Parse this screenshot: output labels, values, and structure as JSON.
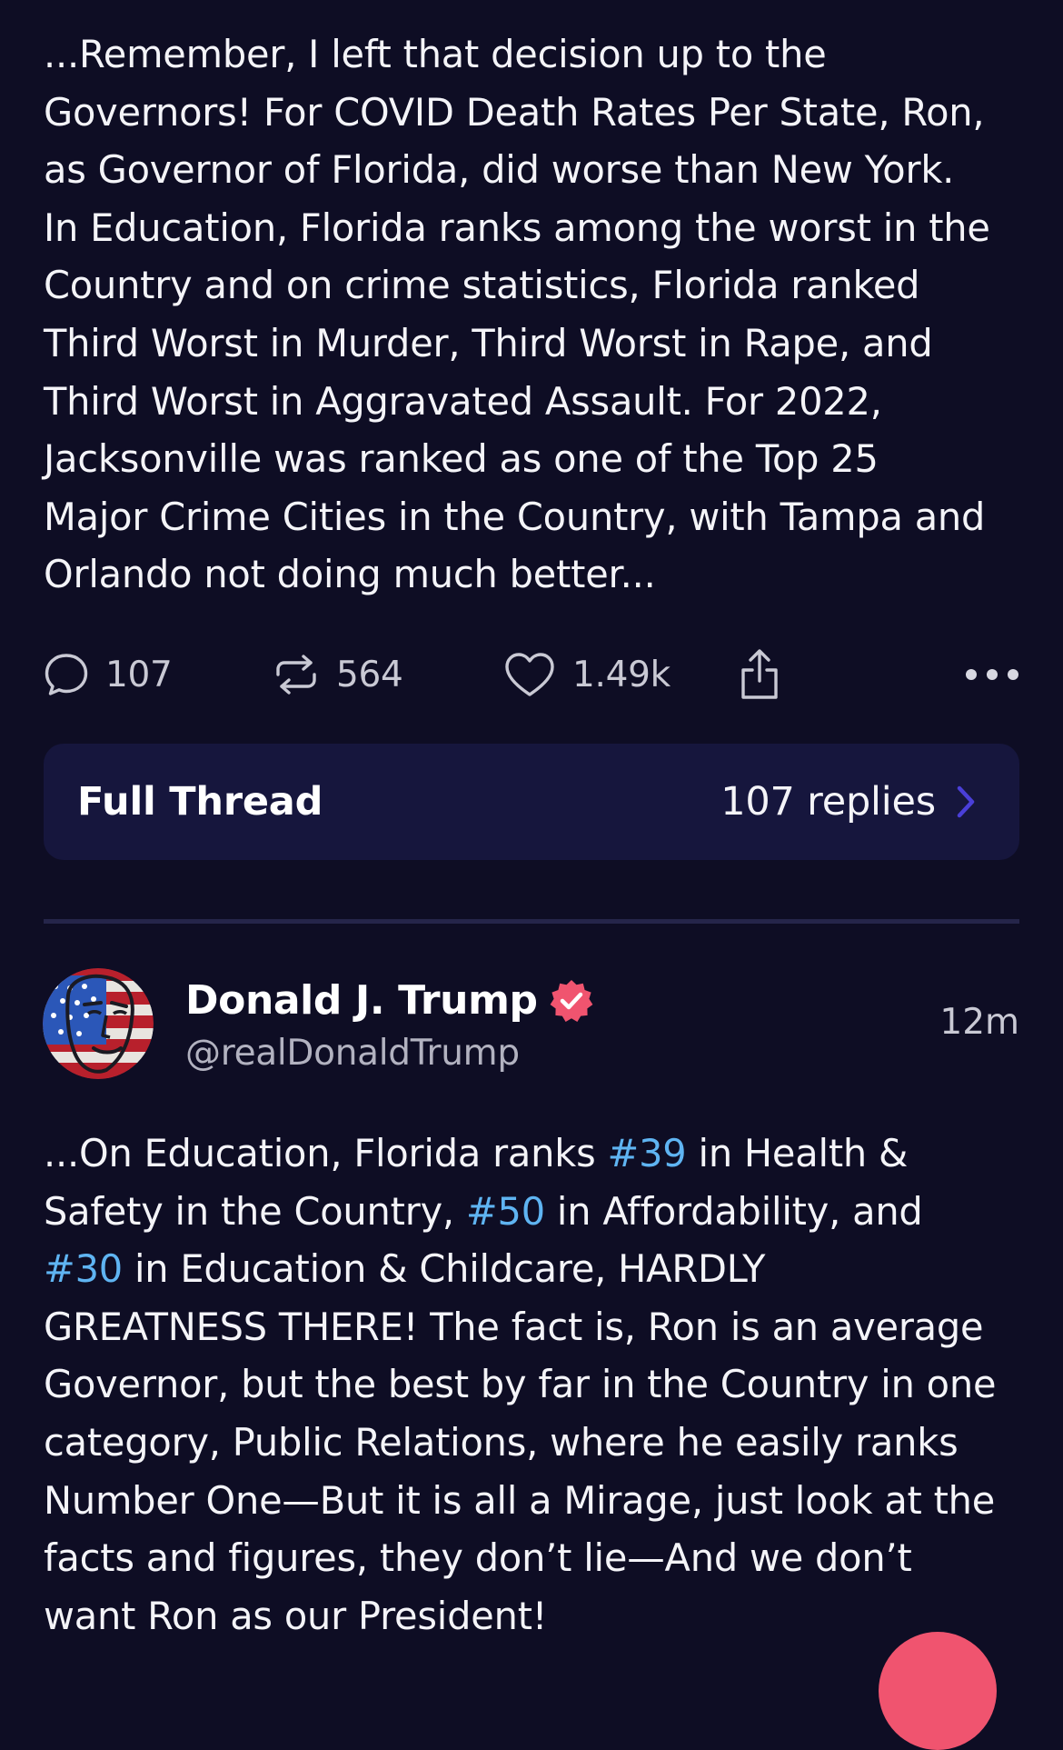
{
  "post1": {
    "text": "...Remember, I left that decision up to the\nGovernors! For COVID Death Rates Per State, Ron,\nas Governor of Florida, did worse than New York.\nIn Education, Florida ranks among the worst in the\nCountry and on crime statistics, Florida ranked\nThird Worst in Murder, Third Worst in Rape, and\nThird Worst in Aggravated Assault. For 2022,\nJacksonville was ranked as one of the Top 25\nMajor Crime Cities in the Country, with Tampa and\nOrlando not doing much better...",
    "actions": {
      "reply_count": "107",
      "retruth_count": "564",
      "like_count": "1.49k"
    },
    "full_thread": {
      "label": "Full Thread",
      "replies": "107 replies"
    }
  },
  "post2": {
    "author": {
      "name": "Donald J. Trump",
      "handle": "@realDonaldTrump",
      "verified": true
    },
    "timestamp": "12m",
    "text_parts": [
      "...On Education, Florida ranks ",
      "#39",
      " in Health &\nSafety in the Country, ",
      "#50",
      " in Affordability, and\n",
      "#30",
      " in Education & Childcare, HARDLY\nGREATNESS THERE! The fact is, Ron is an average\nGovernor, but the best by far in the Country in one\ncategory, Public Relations, where he easily ranks\nNumber One—But it is all a Mirage, just look at the\nfacts and figures, they don’t lie—And we don’t\nwant Ron as our President!"
    ]
  },
  "colors": {
    "background": "#0e0d24",
    "card": "#16163d",
    "hashtag": "#5fb4f2",
    "accent": "#f0546f",
    "verified": "#f0546f"
  },
  "icons": [
    "reply-icon",
    "retruth-icon",
    "like-icon",
    "share-icon",
    "more-icon",
    "chevron-right-icon",
    "verified-badge-icon"
  ]
}
